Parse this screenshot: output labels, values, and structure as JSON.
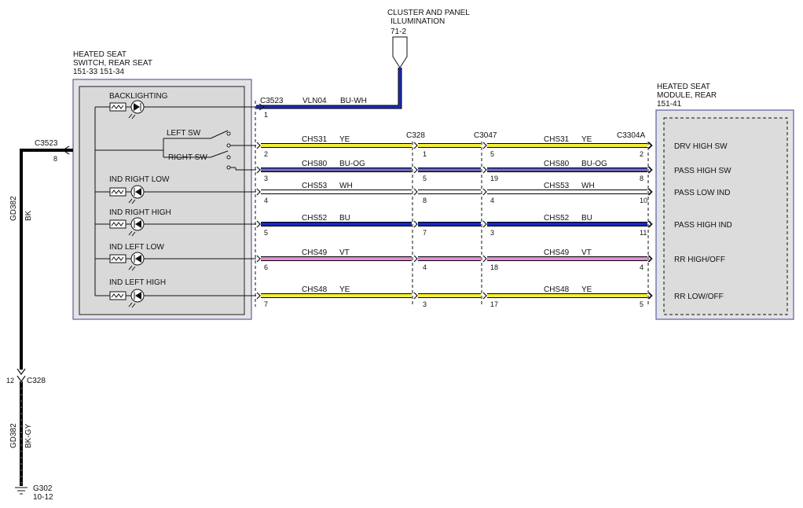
{
  "colors": {
    "YE": "#f2ee3a",
    "BU": "#1428c8",
    "WH": "#ffffff",
    "BU-OG": "#4050c8",
    "VT": "#e28ad8",
    "BU-WH": "#1e2db8",
    "BK": "#000000",
    "box_border": "#5b5fa8"
  },
  "cluster_illumination": {
    "title_line1": "CLUSTER AND PANEL",
    "title_line2": "ILLUMINATION",
    "ref": "71-2"
  },
  "switch_component": {
    "title_line1": "HEATED SEAT",
    "title_line2": "SWITCH, REAR SEAT",
    "ref": "151-33 151-34",
    "labels": {
      "backlighting": "BACKLIGHTING",
      "left_sw": "LEFT SW",
      "right_sw": "RIGHT SW",
      "ind_right_low": "IND RIGHT LOW",
      "ind_right_high": "IND RIGHT HIGH",
      "ind_left_low": "IND LEFT LOW",
      "ind_left_high": "IND LEFT HIGH"
    }
  },
  "module_component": {
    "title_line1": "HEATED SEAT",
    "title_line2": "MODULE, REAR",
    "ref": "151-41",
    "pins": [
      {
        "label": "DRV HIGH SW"
      },
      {
        "label": "PASS HIGH SW"
      },
      {
        "label": "PASS LOW IND"
      },
      {
        "label": "PASS HIGH IND"
      },
      {
        "label": "RR HIGH/OFF"
      },
      {
        "label": "RR LOW/OFF"
      }
    ]
  },
  "connectors": {
    "c3523": "C3523",
    "c328": "C328",
    "c3047": "C3047",
    "c3304a": "C3304A"
  },
  "vln04_circuit": {
    "circuit": "VLN04",
    "color": "BU-WH",
    "pin": "1"
  },
  "signal_circuits": [
    {
      "circuit": "CHS31",
      "color": "YE",
      "pin_sw": "2",
      "pin_c328_in": "",
      "pin_c328_out": "1",
      "pin_c3047": "5",
      "pin_mod": "2"
    },
    {
      "circuit": "CHS80",
      "color": "BU-OG",
      "pin_sw": "3",
      "pin_c328_in": "",
      "pin_c328_out": "5",
      "pin_c3047": "19",
      "pin_mod": "8"
    },
    {
      "circuit": "CHS53",
      "color": "WH",
      "pin_sw": "4",
      "pin_c328_in": "",
      "pin_c328_out": "8",
      "pin_c3047": "4",
      "pin_mod": "10"
    },
    {
      "circuit": "CHS52",
      "color": "BU",
      "pin_sw": "5",
      "pin_c328_in": "",
      "pin_c328_out": "7",
      "pin_c3047": "3",
      "pin_mod": "11"
    },
    {
      "circuit": "CHS49",
      "color": "VT",
      "pin_sw": "6",
      "pin_c328_in": "",
      "pin_c328_out": "4",
      "pin_c3047": "18",
      "pin_mod": "4"
    },
    {
      "circuit": "CHS48",
      "color": "YE",
      "pin_sw": "7",
      "pin_c328_in": "",
      "pin_c328_out": "3",
      "pin_c3047": "17",
      "pin_mod": "5"
    }
  ],
  "ground": {
    "c3523_label": "C3523",
    "c3523_pin": "8",
    "upper_circuit": "GD382",
    "upper_color": "BK",
    "c328_label": "C328",
    "c328_pin": "12",
    "lower_circuit": "GD382",
    "lower_color": "BK-GY",
    "ground_label": "G302",
    "ground_ref": "10-12"
  }
}
